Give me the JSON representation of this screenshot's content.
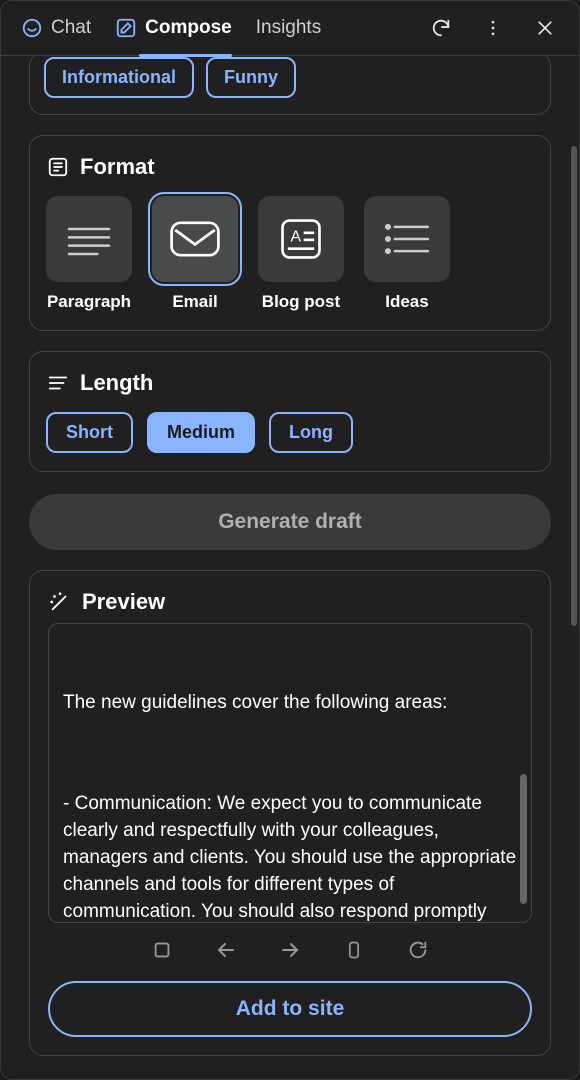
{
  "tabs": {
    "chat": "Chat",
    "compose": "Compose",
    "insights": "Insights"
  },
  "tone": {
    "informational": "Informational",
    "funny": "Funny"
  },
  "format": {
    "title": "Format",
    "paragraph": "Paragraph",
    "email": "Email",
    "blog": "Blog post",
    "ideas": "Ideas"
  },
  "length": {
    "title": "Length",
    "short": "Short",
    "medium": "Medium",
    "long": "Long"
  },
  "generate_label": "Generate draft",
  "preview": {
    "title": "Preview",
    "text_intro": "The new guidelines cover the following areas:",
    "text_body": "- Communication: We expect you to communicate clearly and respectfully with your colleagues, managers and clients. You should use the appropriate channels and tools for different types of communication. You should also respond promptly and professionally to any inquiries or"
  },
  "add_label": "Add to site"
}
